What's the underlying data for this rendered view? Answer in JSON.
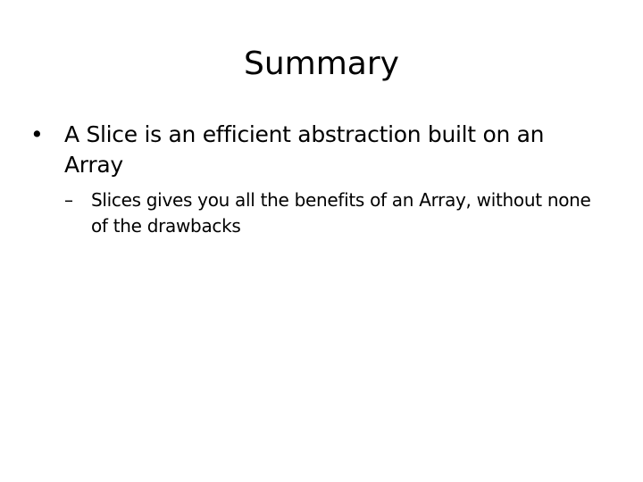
{
  "slide": {
    "title": "Summary",
    "bullets": [
      {
        "marker": "•",
        "text": "A Slice is an efficient abstraction built on an Array",
        "sub": [
          {
            "marker": "–",
            "text": "Slices gives you all the benefits of an Array, without none of the drawbacks"
          }
        ]
      }
    ]
  }
}
